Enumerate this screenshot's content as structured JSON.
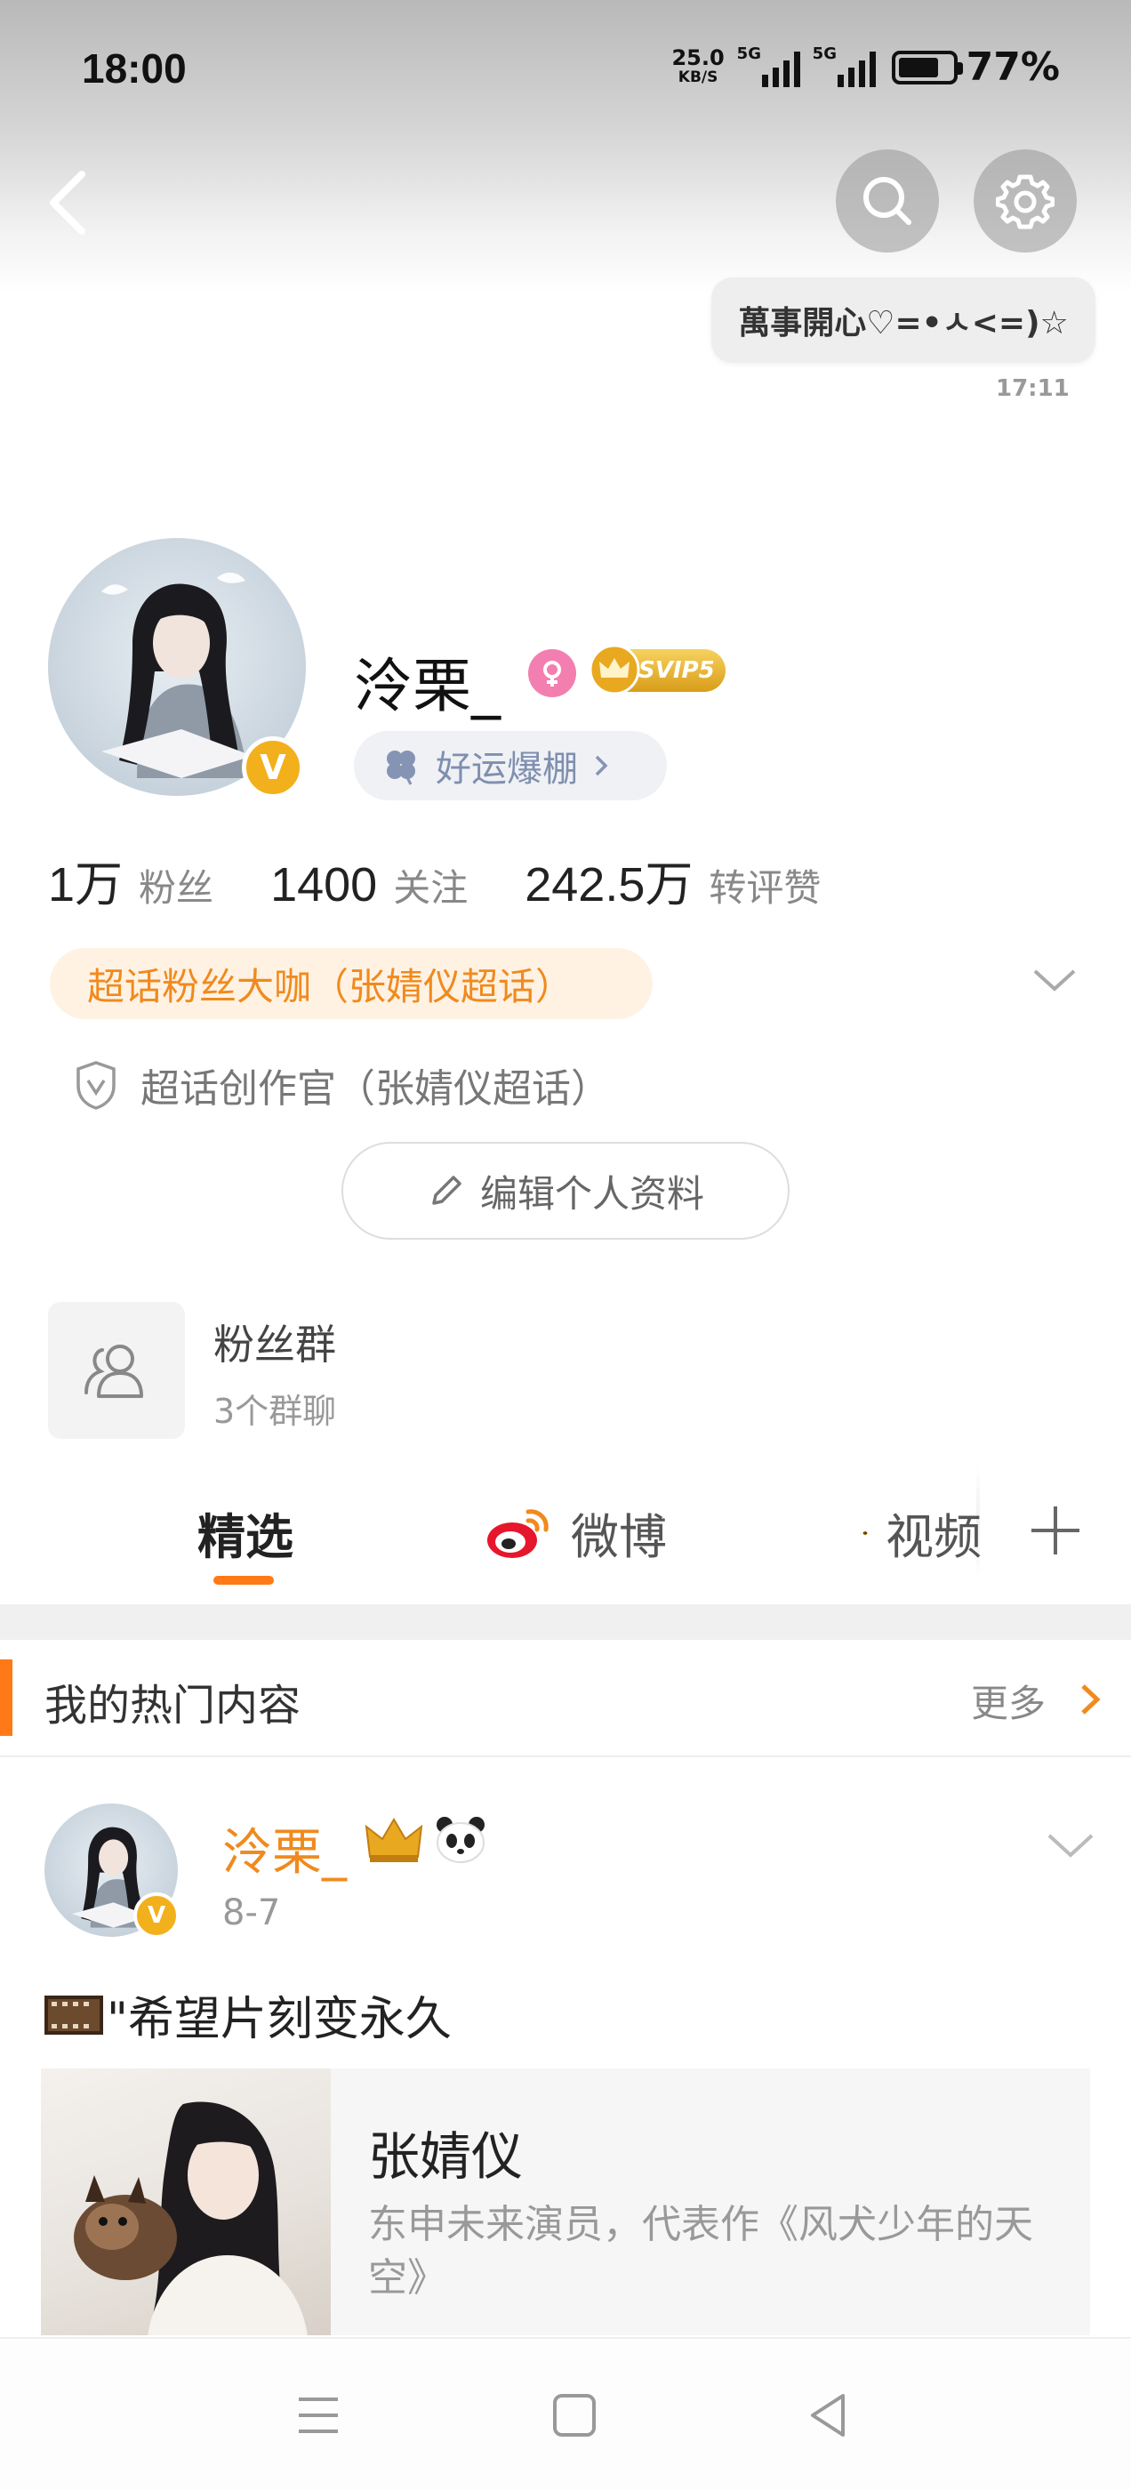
{
  "status_bar": {
    "time": "18:00",
    "net_speed": "25.0",
    "net_unit": "KB/S",
    "sim1": "5G",
    "sim2": "5G",
    "battery": "77%",
    "battery_level": 0.77
  },
  "bubble": {
    "text": "萬事開心♡=•ㅅ<=)☆",
    "time": "17:11"
  },
  "profile": {
    "username": "泠栗_",
    "svip": "SVIP5",
    "luck_label": "好运爆棚",
    "stats": [
      {
        "value": "1万",
        "label": "粉丝"
      },
      {
        "value": "1400",
        "label": "关注"
      },
      {
        "value": "242.5万",
        "label": "转评赞"
      }
    ],
    "fan_tag": "超话粉丝大咖（张婧仪超话）",
    "creator": "超话创作官（张婧仪超话）",
    "edit_label": "编辑个人资料"
  },
  "group": {
    "title": "粉丝群",
    "subtitle": "3个群聊"
  },
  "tabs": [
    {
      "label": "精选"
    },
    {
      "label": "微博"
    },
    {
      "label": "视频"
    }
  ],
  "hot": {
    "title": "我的热门内容",
    "more": "更多"
  },
  "post": {
    "author": "泠栗_",
    "date": "8-7",
    "text": "\"希望片刻变永久",
    "card_title": "张婧仪",
    "card_desc": "东申未来演员，代表作《风犬少年的天空》"
  },
  "colors": {
    "accent": "#ff7a16",
    "fan_tag_bg": "#fff2e3",
    "verified": "#f2b01c"
  },
  "icons": [
    "back-arrow-icon",
    "search-icon",
    "gear-icon",
    "female-icon",
    "crown-icon",
    "clover-icon",
    "chevron-right-icon",
    "chevron-down-icon",
    "shield-v-icon",
    "pencil-icon",
    "people-icon",
    "weibo-icon",
    "video-badge-icon",
    "plus-icon",
    "film-icon",
    "menu-icon",
    "home-square-icon",
    "back-triangle-icon"
  ]
}
